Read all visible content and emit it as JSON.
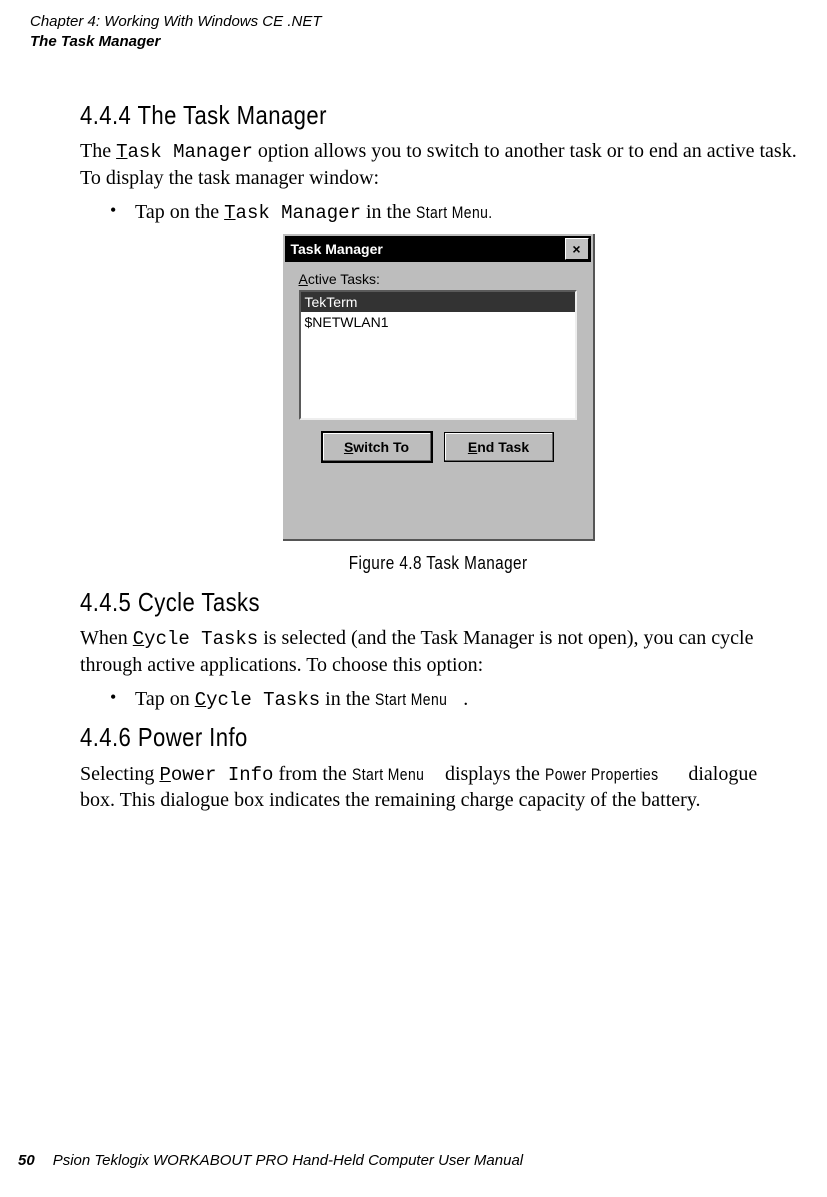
{
  "header": {
    "chapter": "Chapter 4: Working With Windows CE .NET",
    "section": "The Task Manager"
  },
  "s1": {
    "heading": "4.4.4  The Task Manager",
    "p_pre": "The ",
    "p_code_u": "T",
    "p_code_rest": "ask Manager",
    "p_post": " option allows you to switch to another task or to end an active task. To display the task manager window:",
    "bullet_pre": "Tap on the ",
    "bullet_code_u": "T",
    "bullet_code_rest": "ask Manager",
    "bullet_mid": " in the ",
    "bullet_kw": "Start Menu."
  },
  "taskmgr": {
    "title": "Task Manager",
    "close": "×",
    "label_u": "A",
    "label_rest": "ctive Tasks:",
    "items": [
      "TekTerm",
      "$NETWLAN1"
    ],
    "btn1_u": "S",
    "btn1_rest": "witch To",
    "btn2_u": "E",
    "btn2_rest": "nd Task"
  },
  "figcap": "Figure 4.8 Task Manager",
  "s2": {
    "heading": "4.4.5  Cycle Tasks",
    "p_pre": "When ",
    "p_code_u": "C",
    "p_code_rest": "ycle Tasks",
    "p_post": " is selected (and the Task Manager is not open), you can cycle through active applications. To choose this option:",
    "bullet_pre": "Tap on ",
    "bullet_code_u": "C",
    "bullet_code_rest": "ycle Tasks",
    "bullet_mid": " in the ",
    "bullet_kw": "Start Menu",
    "bullet_end": "."
  },
  "s3": {
    "heading": "4.4.6  Power Info",
    "p_pre": "Selecting ",
    "p_code_u": "P",
    "p_code_rest": "ower Info",
    "p_mid1": " from the ",
    "kw1": "Start Menu",
    "p_mid2": " displays the ",
    "kw2": "Power Properties",
    "p_post": " dialogue box. This dialogue box indicates the remaining charge capacity of the battery."
  },
  "footer": {
    "page": "50",
    "title": "Psion Teklogix WORKABOUT PRO Hand-Held Computer User Manual"
  }
}
